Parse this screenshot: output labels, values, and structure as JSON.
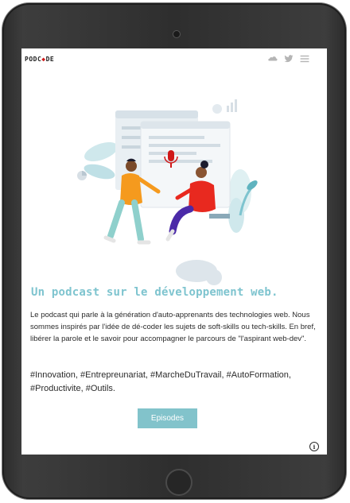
{
  "header": {
    "logo_text": "PODC",
    "logo_mic_char": "◆",
    "logo_tail": "DE",
    "icons": [
      "soundcloud-icon",
      "twitter-icon",
      "menu-icon"
    ]
  },
  "hero": {
    "illustration": "podcast-people-illustration",
    "headline": "Un podcast sur le développement web.",
    "description": "Le podcast qui parle à la génération d'auto-apprenants des technologies web. Nous sommes inspirés par l'idée de dé-coder les sujets de soft-skills ou tech-skills. En bref, libérer la parole et le savoir pour accompagner le parcours de \"l'aspirant web-dev\".",
    "hashtags": "#Innovation, #Entrepreunariat, #MarcheDuTravail, #AutoFormation, #Productivite, #Outils.",
    "cta_label": "Episodes"
  },
  "footer": {
    "info_glyph": "i"
  },
  "colors": {
    "accent": "#7ec4cf",
    "button": "#82c3cb",
    "mic_red": "#d01818",
    "text": "#2b2b2b",
    "device_frame": "#2e2e2e"
  }
}
